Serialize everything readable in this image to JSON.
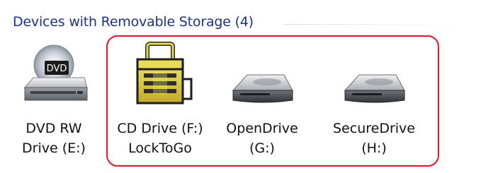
{
  "group": {
    "header": "Devices with Removable Storage (4)"
  },
  "drives": [
    {
      "label": "DVD RW\nDrive (E:)",
      "icon": "dvd-drive-icon"
    },
    {
      "label": "CD Drive (F:)\nLockToGo",
      "icon": "locked-drive-icon"
    },
    {
      "label": "OpenDrive\n(G:)",
      "icon": "removable-drive-icon"
    },
    {
      "label": "SecureDrive\n(H:)",
      "icon": "removable-drive-icon"
    }
  ],
  "colors": {
    "header_text": "#1e3287",
    "highlight_border": "#e0142c"
  }
}
